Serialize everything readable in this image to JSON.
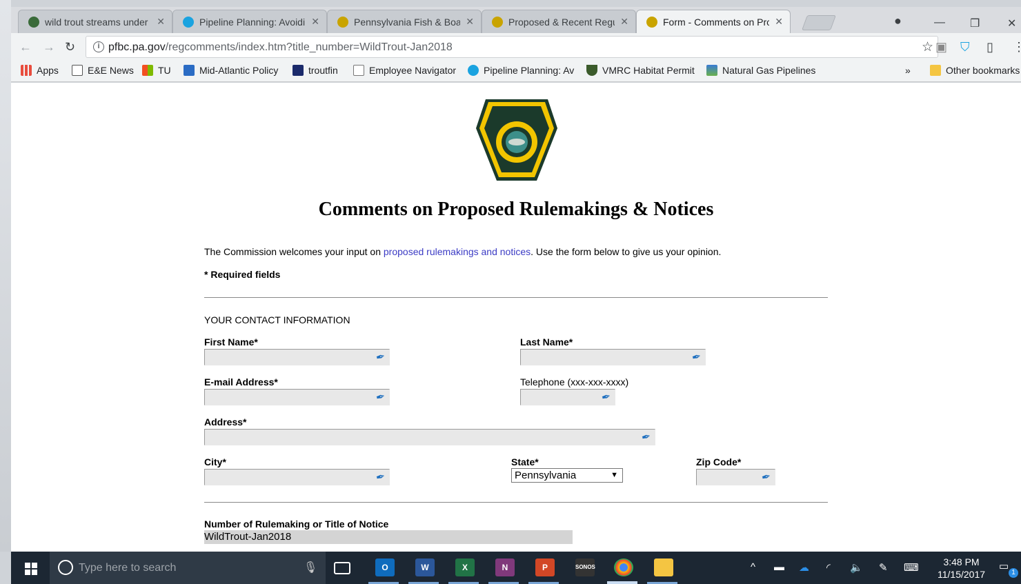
{
  "tabs": [
    {
      "title": "wild trout streams under",
      "color": "#3a6b3a"
    },
    {
      "title": "Pipeline Planning: Avoidi",
      "color": "#1aa3e0"
    },
    {
      "title": "Pennsylvania Fish & Boat",
      "color": "#c9a400"
    },
    {
      "title": "Proposed & Recent Regu",
      "color": "#c9a400"
    },
    {
      "title": "Form - Comments on Prc",
      "color": "#c9a400"
    }
  ],
  "address": {
    "domain": "pfbc.pa.gov",
    "path": "/regcomments/index.htm?title_number=WildTrout-Jan2018"
  },
  "bookmarks": [
    {
      "label": "Apps",
      "color": "#e84c3d"
    },
    {
      "label": "E&E News",
      "color": "#555555"
    },
    {
      "label": "TU",
      "color": "#f25022"
    },
    {
      "label": "Mid-Atlantic Policy",
      "color": "#2b6cc4"
    },
    {
      "label": "troutfin",
      "color": "#1b2a6b"
    },
    {
      "label": "Employee Navigator",
      "color": "#ffffff"
    },
    {
      "label": "Pipeline Planning: Av",
      "color": "#1aa3e0"
    },
    {
      "label": "VMRC Habitat Permit",
      "color": "#3b5b2b"
    },
    {
      "label": "Natural Gas Pipelines",
      "color": "#3a7bd5"
    }
  ],
  "bookmarks_more": "»",
  "other_bookmarks": "Other bookmarks",
  "page": {
    "title": "Comments on Proposed Rulemakings & Notices",
    "intro_before": "The Commission welcomes your input on ",
    "intro_link": "proposed rulemakings and notices",
    "intro_after": ". Use the form below to give us your opinion.",
    "required": "* Required fields",
    "section": "YOUR CONTACT INFORMATION",
    "labels": {
      "first_name": "First Name*",
      "last_name": "Last Name*",
      "email": "E-mail Address*",
      "telephone": "Telephone (xxx-xxx-xxxx)",
      "address": "Address*",
      "city": "City*",
      "state": "State*",
      "zip": "Zip Code*",
      "rulemaking": "Number of Rulemaking or Title of Notice"
    },
    "state_value": "Pennsylvania",
    "rulemaking_value": "WildTrout-Jan2018"
  },
  "taskbar": {
    "search_placeholder": "Type here to search",
    "time": "3:48 PM",
    "date": "11/15/2017",
    "notification_count": "1"
  },
  "colors": {
    "link": "#3b3bc4",
    "taskbar": "#1c2733"
  }
}
